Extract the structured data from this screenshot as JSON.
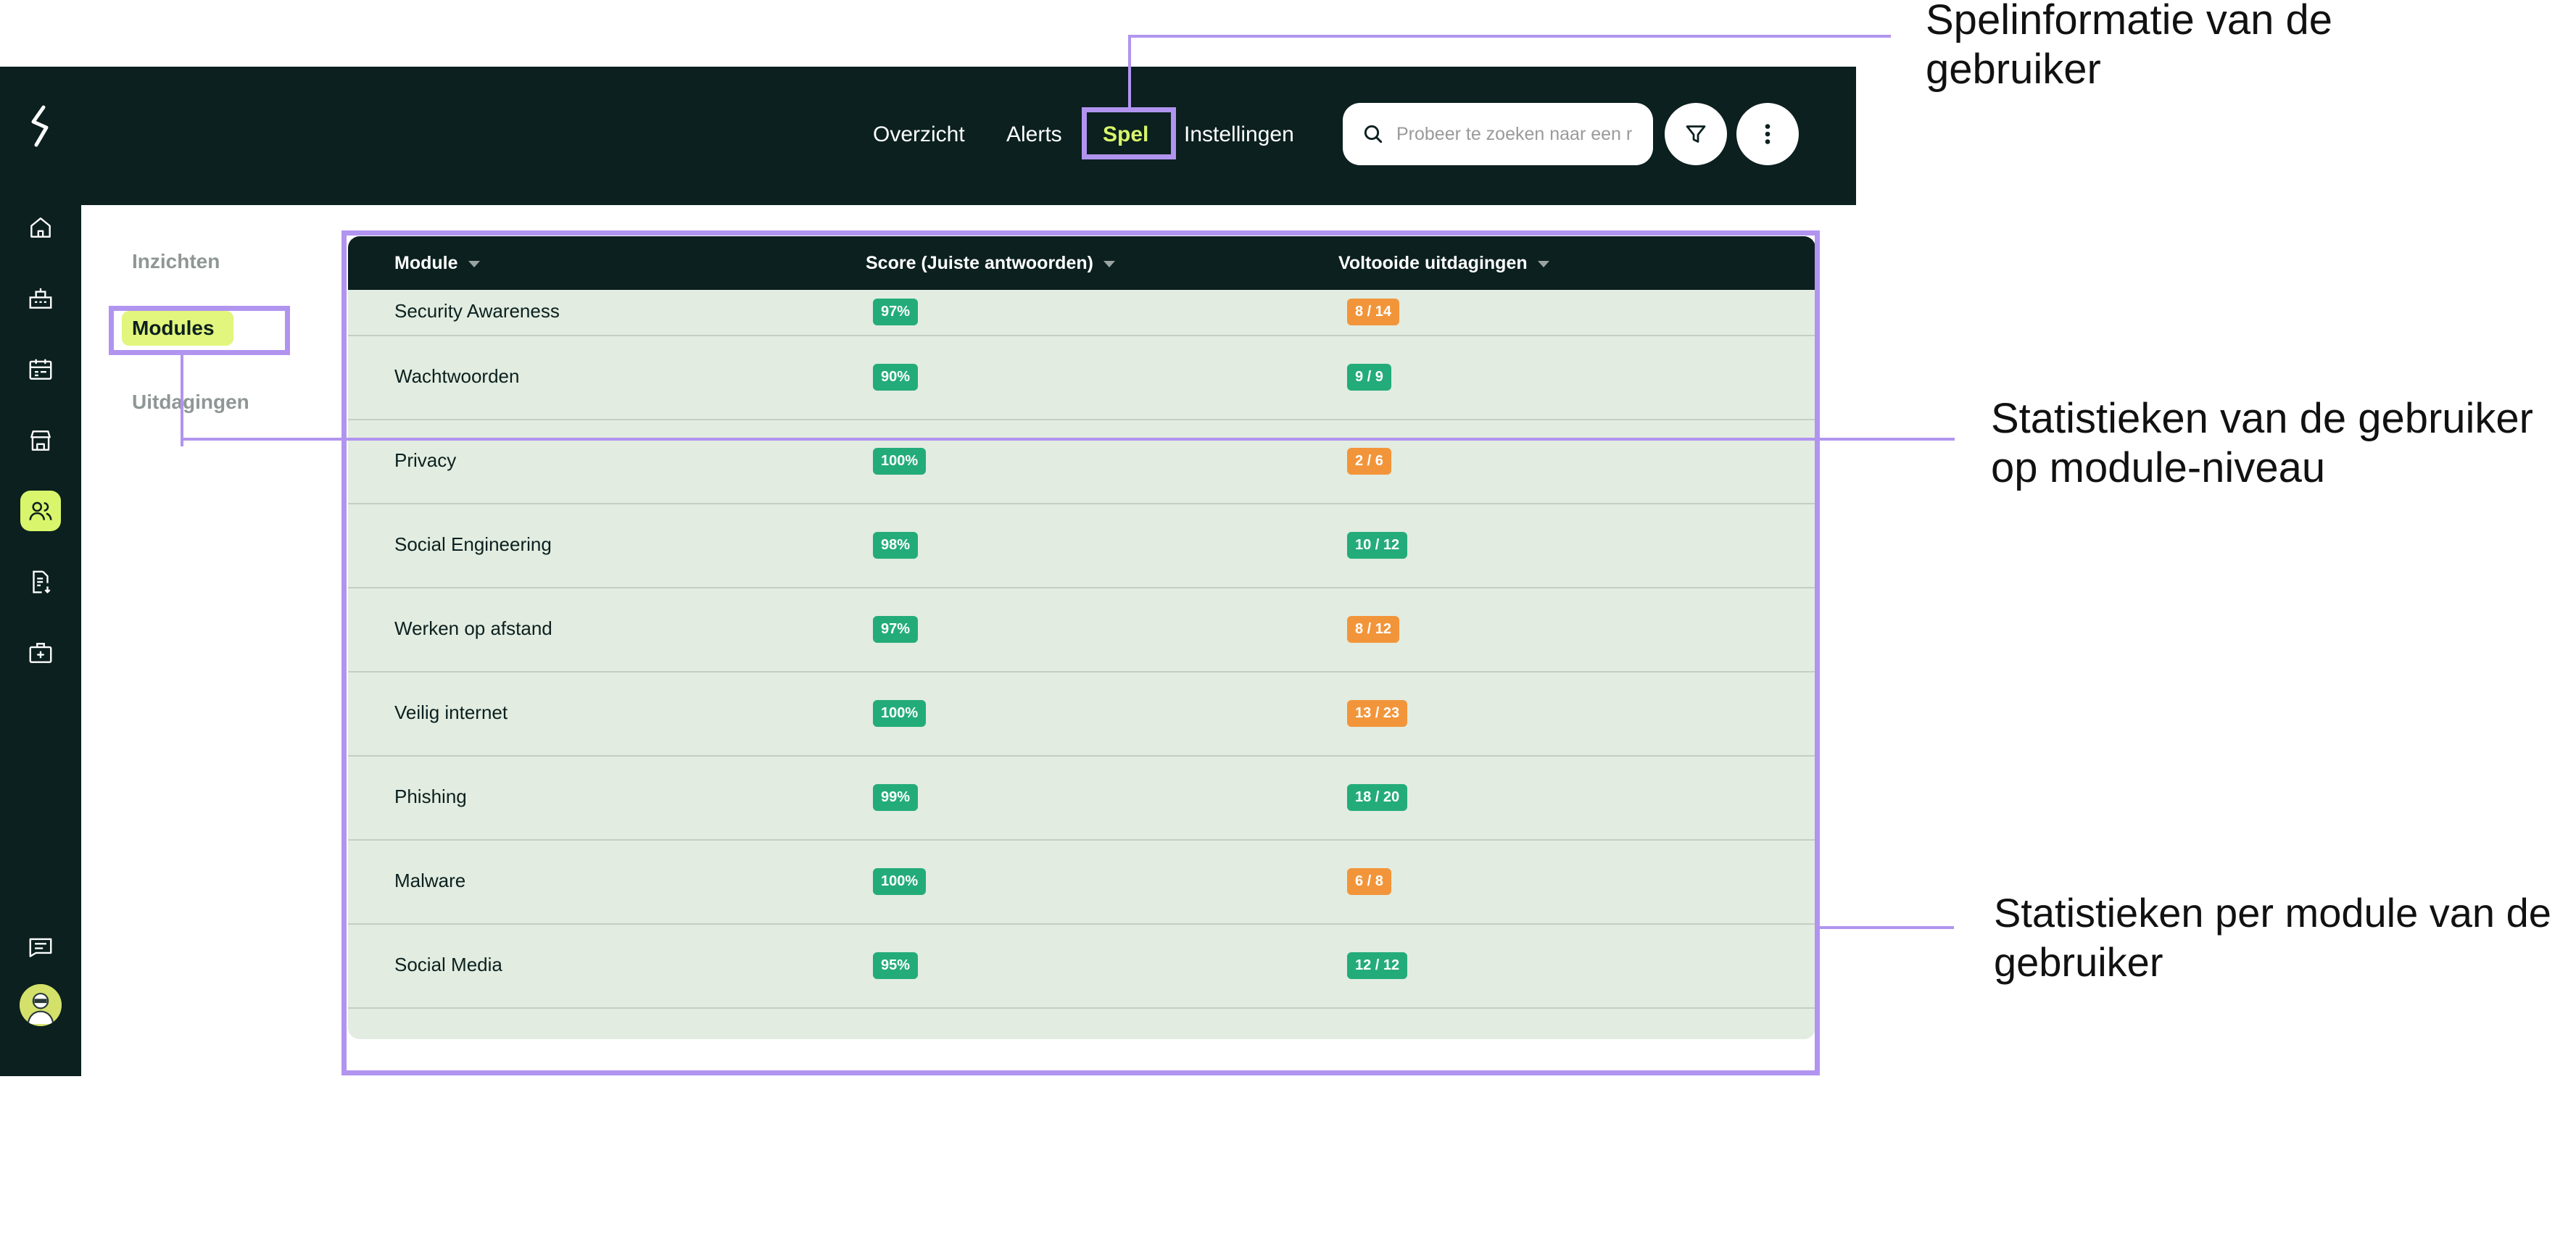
{
  "topnav": {
    "items": [
      {
        "label": "Overzicht"
      },
      {
        "label": "Alerts"
      },
      {
        "label": "Spel"
      },
      {
        "label": "Instellingen"
      }
    ],
    "active_index": 2
  },
  "search": {
    "placeholder": "Probeer te zoeken naar een r"
  },
  "sidebar": {
    "icons": [
      "home-icon",
      "organization-icon",
      "calendar-icon",
      "store-icon",
      "users-icon",
      "report-icon",
      "medical-kit-icon",
      "chat-icon"
    ],
    "active_icon": "users-icon"
  },
  "subnav": {
    "items": [
      {
        "label": "Inzichten"
      },
      {
        "label": "Modules"
      },
      {
        "label": "Uitdagingen"
      }
    ],
    "active_index": 1
  },
  "table": {
    "columns": [
      "Module",
      "Score (Juiste antwoorden)",
      "Voltooide uitdagingen"
    ],
    "rows": [
      {
        "module": "Security Awareness",
        "score": "97%",
        "completed": "8 / 14",
        "completed_status": "orange"
      },
      {
        "module": "Wachtwoorden",
        "score": "90%",
        "completed": "9 / 9",
        "completed_status": "green"
      },
      {
        "module": "Privacy",
        "score": "100%",
        "completed": "2 / 6",
        "completed_status": "orange"
      },
      {
        "module": "Social Engineering",
        "score": "98%",
        "completed": "10 / 12",
        "completed_status": "green"
      },
      {
        "module": "Werken op afstand",
        "score": "97%",
        "completed": "8 / 12",
        "completed_status": "orange"
      },
      {
        "module": "Veilig internet",
        "score": "100%",
        "completed": "13 / 23",
        "completed_status": "orange"
      },
      {
        "module": "Phishing",
        "score": "99%",
        "completed": "18 / 20",
        "completed_status": "green"
      },
      {
        "module": "Malware",
        "score": "100%",
        "completed": "6 / 8",
        "completed_status": "orange"
      },
      {
        "module": "Social Media",
        "score": "95%",
        "completed": "12 / 12",
        "completed_status": "green"
      }
    ]
  },
  "annotations": {
    "spel_line1": "Spelinformatie van de",
    "spel_line2": "gebruiker",
    "module_line1": "Statistieken van de gebruiker",
    "module_line2": "op module-niveau",
    "table_line1": "Statistieken per module van de",
    "table_line2": "gebruiker"
  },
  "colors": {
    "dark": "#0b201f",
    "accent": "#d9f56b",
    "row_bg": "#e2ece0",
    "badge_green": "#23ac79",
    "badge_orange": "#f2953a",
    "annotation": "#b194ef"
  }
}
